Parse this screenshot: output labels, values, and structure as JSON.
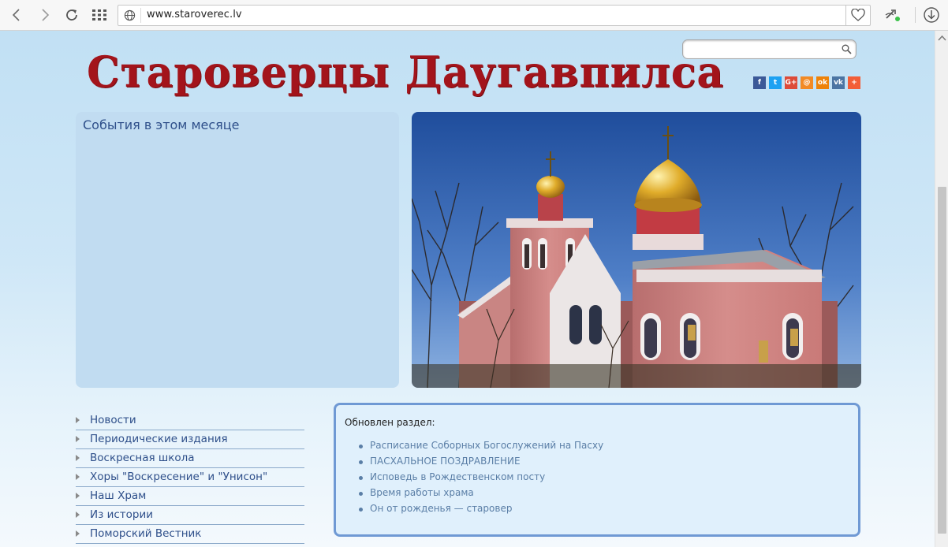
{
  "browser": {
    "url": "www.staroverec.lv"
  },
  "site": {
    "title": "Староверцы Даугавпилса"
  },
  "search": {
    "placeholder": ""
  },
  "social": [
    {
      "name": "facebook",
      "glyph": "f",
      "color": "#3b5998"
    },
    {
      "name": "twitter",
      "glyph": "t",
      "color": "#1da1f2"
    },
    {
      "name": "google-plus",
      "glyph": "G+",
      "color": "#dd4b39"
    },
    {
      "name": "moi-mir",
      "glyph": "@",
      "color": "#f28a24"
    },
    {
      "name": "odnoklassniki",
      "glyph": "ok",
      "color": "#ee8208"
    },
    {
      "name": "vkontakte",
      "glyph": "vk",
      "color": "#4c75a3"
    },
    {
      "name": "more",
      "glyph": "+",
      "color": "#f35e38"
    }
  ],
  "events": {
    "title": "События в этом месяце"
  },
  "menu": {
    "items": [
      "Новости",
      "Периодические издания",
      "Воскресная школа",
      "Хоры \"Воскресение\" и \"Унисон\"",
      "Наш Храм",
      "Из истории",
      "Поморский Вестник"
    ]
  },
  "updated": {
    "title": "Обновлен раздел:",
    "items": [
      "Расписание Соборных Богослужений на Пасху",
      "ПАСХАЛЬНОЕ ПОЗДРАВЛЕНИЕ",
      "Исповедь в Рождественском посту",
      "Время работы храма",
      "Он от рожденья — старовер"
    ]
  }
}
